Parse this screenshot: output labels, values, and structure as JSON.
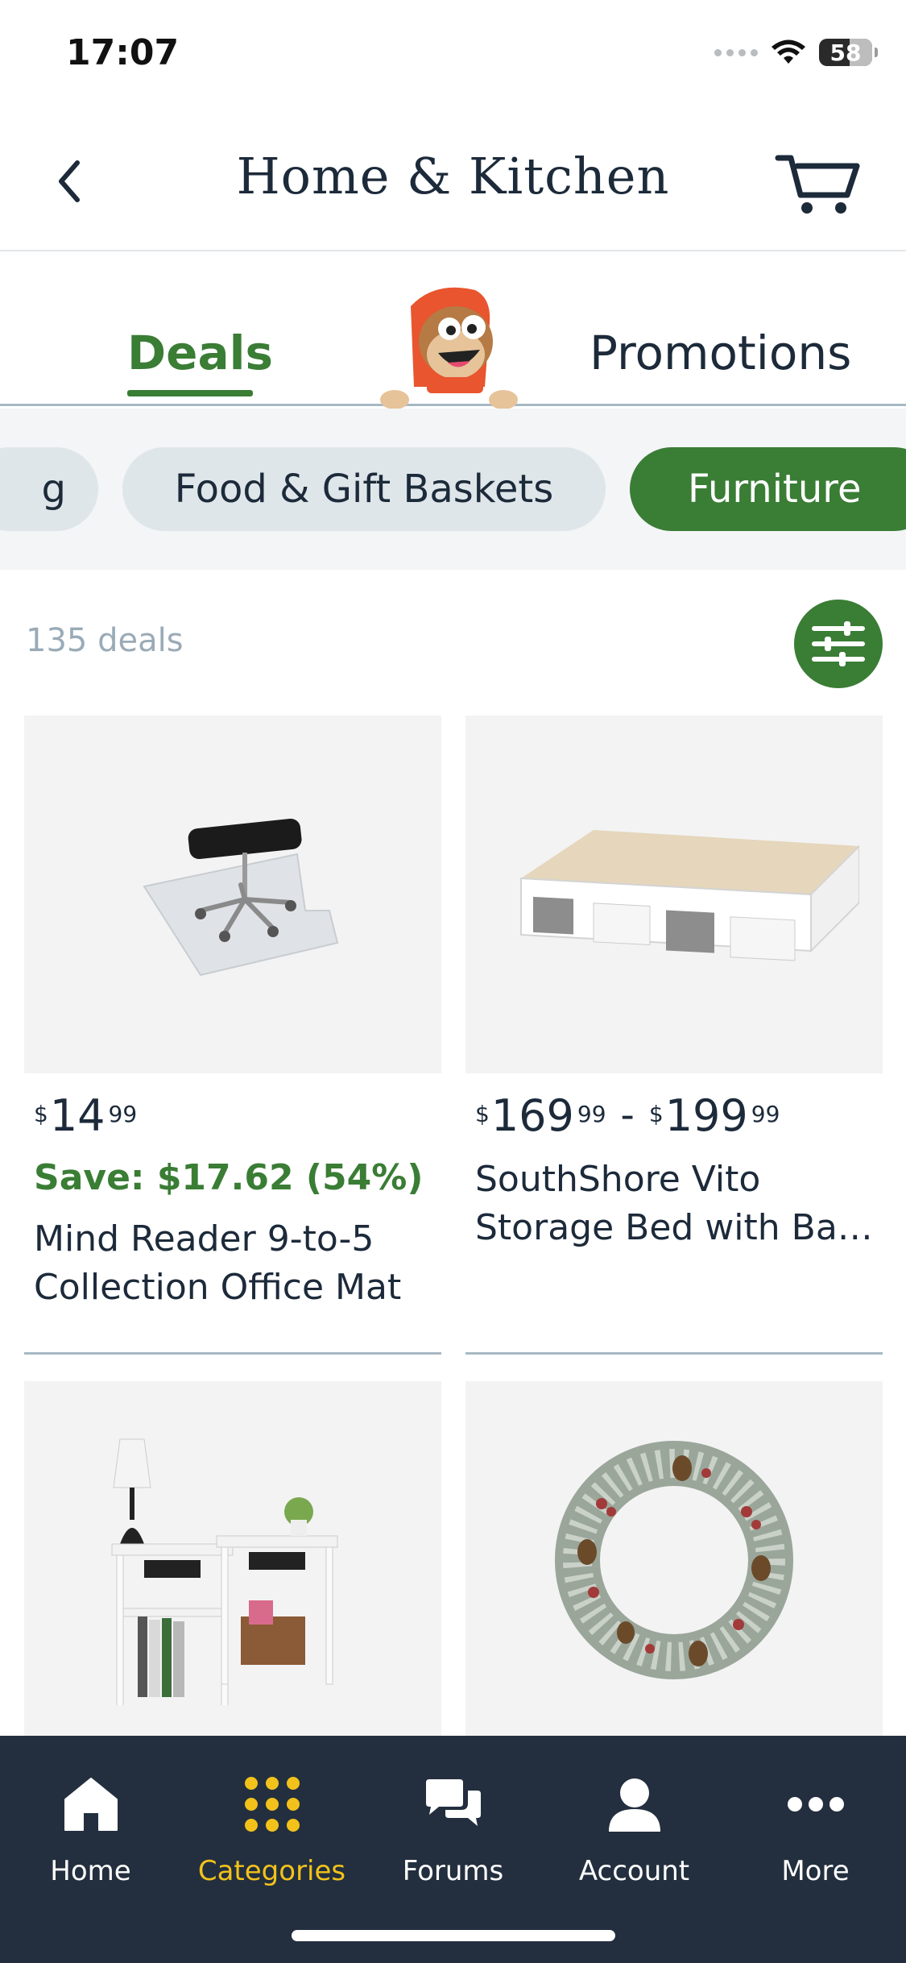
{
  "status_bar": {
    "time": "17:07",
    "battery": "58"
  },
  "header": {
    "title": "Home & Kitchen"
  },
  "tabs": [
    {
      "label": "Deals",
      "active": true
    },
    {
      "label": "Promotions",
      "active": false
    }
  ],
  "chips": [
    {
      "label": "g",
      "active": false
    },
    {
      "label": "Food & Gift Baskets",
      "active": false
    },
    {
      "label": "Furniture",
      "active": true
    }
  ],
  "deals_count": "135 deals",
  "products": [
    {
      "price_currency": "$",
      "price_whole": "14",
      "price_fraction": "99",
      "save": "Save: $17.62 (54%)",
      "name_line1": "Mind Reader 9-to-5",
      "name_line2": "Collection Office Mat",
      "image": "office-chair-mat"
    },
    {
      "price_currency": "$",
      "price_whole": "169",
      "price_fraction": "99",
      "price_max_currency": "$",
      "price_max_whole": "199",
      "price_max_fraction": "99",
      "range_separator": "-",
      "name_line1": "SouthShore Vito",
      "name_line2": "Storage Bed with Ba…",
      "image": "storage-bed"
    },
    {
      "image": "nightstands"
    },
    {
      "image": "christmas-wreath"
    }
  ],
  "bottom_nav": [
    {
      "label": "Home",
      "icon": "home-icon",
      "active": false
    },
    {
      "label": "Categories",
      "icon": "grid-dots-icon",
      "active": true
    },
    {
      "label": "Forums",
      "icon": "chat-bubbles-icon",
      "active": false
    },
    {
      "label": "Account",
      "icon": "person-icon",
      "active": false
    },
    {
      "label": "More",
      "icon": "more-dots-icon",
      "active": false
    }
  ],
  "colors": {
    "brand_green": "#3a7d35",
    "nav_bg": "#232f3e",
    "nav_active": "#f2c21b",
    "chip_bg": "#dfe6ea"
  }
}
